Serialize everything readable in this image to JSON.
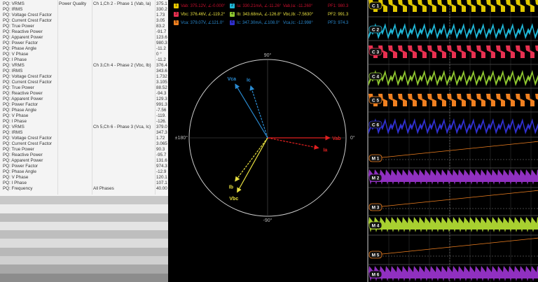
{
  "table": {
    "rows": [
      {
        "name": "PQ: VRMS",
        "group": "Power Quality",
        "channel": "Ch 1,Ch 2 - Phase 1 (Vab, Ia)",
        "value": "375.1"
      },
      {
        "name": "PQ: IRMS",
        "group": "",
        "channel": "",
        "value": "330.2"
      },
      {
        "name": "PQ: Voltage Crest Factor",
        "group": "",
        "channel": "",
        "value": "1.73"
      },
      {
        "name": "PQ: Current Crest Factor",
        "group": "",
        "channel": "",
        "value": "3.05"
      },
      {
        "name": "PQ: True Power",
        "group": "",
        "channel": "",
        "value": "83.2"
      },
      {
        "name": "PQ: Reactive Power",
        "group": "",
        "channel": "",
        "value": "-91.7"
      },
      {
        "name": "PQ: Apparent Power",
        "group": "",
        "channel": "",
        "value": "123.6"
      },
      {
        "name": "PQ: Power Factor",
        "group": "",
        "channel": "",
        "value": "980.3"
      },
      {
        "name": "PQ: Phase Angle",
        "group": "",
        "channel": "",
        "value": "-11.2"
      },
      {
        "name": "PQ: V Phase",
        "group": "",
        "channel": "",
        "value": "0 °"
      },
      {
        "name": "PQ: I Phase",
        "group": "",
        "channel": "",
        "value": "-11.2"
      },
      {
        "name": "PQ: VRMS",
        "group": "",
        "channel": "Ch 3,Ch 4 - Phase 2 (Vbc, Ib)",
        "value": "376.4"
      },
      {
        "name": "PQ: IRMS",
        "group": "",
        "channel": "",
        "value": "343.6"
      },
      {
        "name": "PQ: Voltage Crest Factor",
        "group": "",
        "channel": "",
        "value": "1.732"
      },
      {
        "name": "PQ: Current Crest Factor",
        "group": "",
        "channel": "",
        "value": "3.105"
      },
      {
        "name": "PQ: True Power",
        "group": "",
        "channel": "",
        "value": "88.52"
      },
      {
        "name": "PQ: Reactive Power",
        "group": "",
        "channel": "",
        "value": "-94.3"
      },
      {
        "name": "PQ: Apparent Power",
        "group": "",
        "channel": "",
        "value": "129.3"
      },
      {
        "name": "PQ: Power Factor",
        "group": "",
        "channel": "",
        "value": "991.3"
      },
      {
        "name": "PQ: Phase Angle",
        "group": "",
        "channel": "",
        "value": "-7.56"
      },
      {
        "name": "PQ: V Phase",
        "group": "",
        "channel": "",
        "value": "-119."
      },
      {
        "name": "PQ: I Phase",
        "group": "",
        "channel": "",
        "value": "-126."
      },
      {
        "name": "PQ: VRMS",
        "group": "",
        "channel": "Ch 5,Ch 6 - Phase 3 (Vca, Ic)",
        "value": "379.0"
      },
      {
        "name": "PQ: IRMS",
        "group": "",
        "channel": "",
        "value": "347.3"
      },
      {
        "name": "PQ: Voltage Crest Factor",
        "group": "",
        "channel": "",
        "value": "1.72"
      },
      {
        "name": "PQ: Current Crest Factor",
        "group": "",
        "channel": "",
        "value": "3.065"
      },
      {
        "name": "PQ: True Power",
        "group": "",
        "channel": "",
        "value": "90.3"
      },
      {
        "name": "PQ: Reactive Power",
        "group": "",
        "channel": "",
        "value": "-95.7"
      },
      {
        "name": "PQ: Apparent Power",
        "group": "",
        "channel": "",
        "value": "131.6"
      },
      {
        "name": "PQ: Power Factor",
        "group": "",
        "channel": "",
        "value": "974.3"
      },
      {
        "name": "PQ: Phase Angle",
        "group": "",
        "channel": "",
        "value": "-12.9"
      },
      {
        "name": "PQ: V Phase",
        "group": "",
        "channel": "",
        "value": "120.1"
      },
      {
        "name": "PQ: I Phase",
        "group": "",
        "channel": "",
        "value": "107.1"
      },
      {
        "name": "PQ: Frequency",
        "group": "",
        "channel": "All Phases",
        "value": "40.00"
      }
    ]
  },
  "legend": {
    "rows": [
      {
        "color": "#c8102e",
        "items": [
          {
            "badge": "1",
            "badge_color": "#e8c800",
            "text": "Vab: 375.12V, ∠-0.000°"
          },
          {
            "badge": "2",
            "badge_color": "#20b8d8",
            "text": "Ia: 330.21mA, ∠-11.26°"
          },
          {
            "text": "Vab,Ia: -11.260°"
          },
          {
            "text": "PF1: 980.3"
          }
        ]
      },
      {
        "color": "#e8e040",
        "items": [
          {
            "badge": "3",
            "badge_color": "#e83050",
            "text": "Vbc: 376.46V, ∠-119.2°"
          },
          {
            "badge": "4",
            "badge_color": "#90c830",
            "text": "Ib: 343.68mA, ∠-126.8°"
          },
          {
            "text": "Vbc,Ib: -7.5630°"
          },
          {
            "text": "PF2: 991.3"
          }
        ]
      },
      {
        "color": "#2a8ad0",
        "items": [
          {
            "badge": "5",
            "badge_color": "#f08020",
            "text": "Vca: 379.07V, ∠121.0°"
          },
          {
            "badge": "6",
            "badge_color": "#3030d0",
            "text": "Ic: 347.30mA, ∠108.0°"
          },
          {
            "text": "Vca,Ic: -12.998°"
          },
          {
            "text": "PF3: 974.3"
          }
        ]
      }
    ]
  },
  "phasor": {
    "labels": {
      "top": "90°",
      "bottom": "-90°",
      "left": "±180°",
      "right": "0°"
    },
    "vectors": [
      {
        "name": "Vab",
        "magnitude": 375.12,
        "angle": 0,
        "color": "#e02020",
        "dashed": false
      },
      {
        "name": "Ia",
        "magnitude": 330.21,
        "angle": -11.26,
        "color": "#e02020",
        "dashed": true
      },
      {
        "name": "Vbc",
        "magnitude": 376.46,
        "angle": -119.2,
        "color": "#e8e040",
        "dashed": false
      },
      {
        "name": "Ib",
        "magnitude": 343.68,
        "angle": -126.8,
        "color": "#e8e040",
        "dashed": true
      },
      {
        "name": "Vca",
        "magnitude": 379.07,
        "angle": 121.0,
        "color": "#2a8ad0",
        "dashed": false
      },
      {
        "name": "Ic",
        "magnitude": 347.3,
        "angle": 108.0,
        "color": "#2a8ad0",
        "dashed": true
      }
    ]
  },
  "scope": {
    "channels": [
      {
        "label": "C 1",
        "color": "#e0c800",
        "kind": "square"
      },
      {
        "label": "C 2",
        "color": "#20b8d8",
        "kind": "saw"
      },
      {
        "label": "C 3",
        "color": "#e83050",
        "kind": "square"
      },
      {
        "label": "C 4",
        "color": "#90c830",
        "kind": "saw"
      },
      {
        "label": "C 5",
        "color": "#f08020",
        "kind": "square"
      },
      {
        "label": "C 6",
        "color": "#3030d0",
        "kind": "saw"
      },
      {
        "label": "M 1",
        "color": "#f08020",
        "kind": "ramp"
      },
      {
        "label": "M 2",
        "color": "#9030c0",
        "kind": "dense"
      },
      {
        "label": "M 3",
        "color": "#f08020",
        "kind": "ramp"
      },
      {
        "label": "M 4",
        "color": "#a8d030",
        "kind": "dense"
      },
      {
        "label": "M 5",
        "color": "#f08020",
        "kind": "ramp"
      },
      {
        "label": "M 6",
        "color": "#9030c0",
        "kind": "dense"
      }
    ]
  }
}
